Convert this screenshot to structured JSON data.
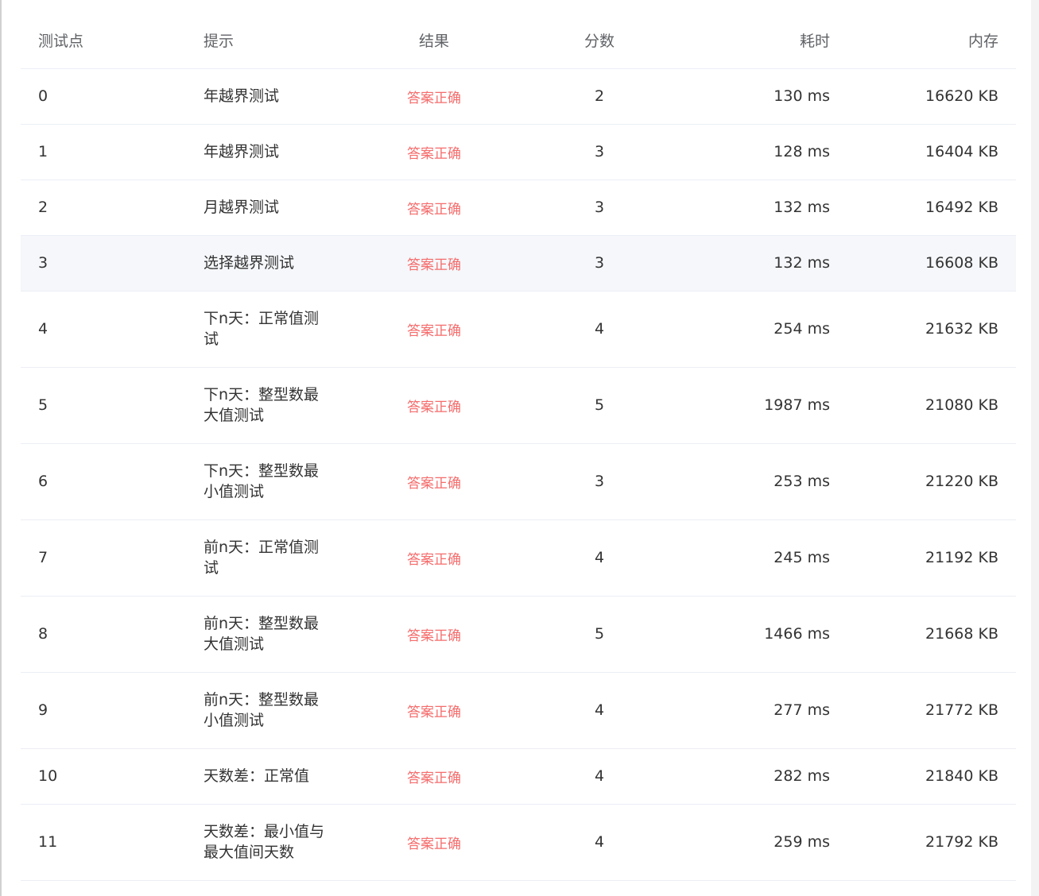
{
  "table": {
    "headers": {
      "index": "测试点",
      "hint": "提示",
      "result": "结果",
      "score": "分数",
      "time": "耗时",
      "memory": "内存"
    },
    "rows": [
      {
        "index": "0",
        "hint": "年越界测试",
        "result": "答案正确",
        "score": "2",
        "time": "130 ms",
        "memory": "16620 KB"
      },
      {
        "index": "1",
        "hint": "年越界测试",
        "result": "答案正确",
        "score": "3",
        "time": "128 ms",
        "memory": "16404 KB"
      },
      {
        "index": "2",
        "hint": "月越界测试",
        "result": "答案正确",
        "score": "3",
        "time": "132 ms",
        "memory": "16492 KB"
      },
      {
        "index": "3",
        "hint": "选择越界测试",
        "result": "答案正确",
        "score": "3",
        "time": "132 ms",
        "memory": "16608 KB"
      },
      {
        "index": "4",
        "hint": "下n天：正常值测试",
        "result": "答案正确",
        "score": "4",
        "time": "254 ms",
        "memory": "21632 KB"
      },
      {
        "index": "5",
        "hint": "下n天：整型数最大值测试",
        "result": "答案正确",
        "score": "5",
        "time": "1987 ms",
        "memory": "21080 KB"
      },
      {
        "index": "6",
        "hint": "下n天：整型数最小值测试",
        "result": "答案正确",
        "score": "3",
        "time": "253 ms",
        "memory": "21220 KB"
      },
      {
        "index": "7",
        "hint": "前n天：正常值测试",
        "result": "答案正确",
        "score": "4",
        "time": "245 ms",
        "memory": "21192 KB"
      },
      {
        "index": "8",
        "hint": "前n天：整型数最大值测试",
        "result": "答案正确",
        "score": "5",
        "time": "1466 ms",
        "memory": "21668 KB"
      },
      {
        "index": "9",
        "hint": "前n天：整型数最小值测试",
        "result": "答案正确",
        "score": "4",
        "time": "277 ms",
        "memory": "21772 KB"
      },
      {
        "index": "10",
        "hint": "天数差：正常值",
        "result": "答案正确",
        "score": "4",
        "time": "282 ms",
        "memory": "21840 KB"
      },
      {
        "index": "11",
        "hint": "天数差：最小值与最大值间天数",
        "result": "答案正确",
        "score": "4",
        "time": "259 ms",
        "memory": "21792 KB"
      }
    ]
  },
  "colors": {
    "correct": "#f56c6c",
    "hover_row": "#f5f7fa",
    "border": "#ebeef5"
  }
}
